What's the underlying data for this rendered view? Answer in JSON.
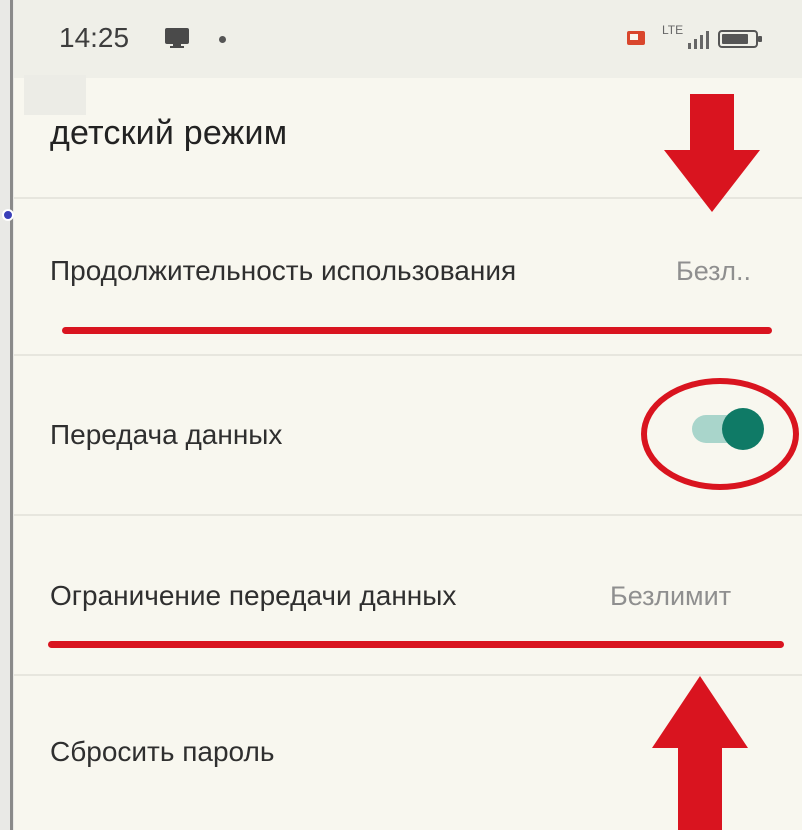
{
  "status_bar": {
    "time": "14:25",
    "network_label": "LTE",
    "notification_icon": "monitor-icon",
    "cast_icon": "cast-icon",
    "signal_icon": "signal-icon",
    "battery_icon": "battery-icon"
  },
  "header": {
    "title": "детский режим"
  },
  "settings": {
    "usage_duration": {
      "label": "Продолжительность использования",
      "value": "Безл.."
    },
    "data_transfer": {
      "label": "Передача данных",
      "toggle_on": true
    },
    "data_limit": {
      "label": "Ограничение передачи данных",
      "value": "Безлимит"
    },
    "reset_password": {
      "label": "Сбросить пароль"
    }
  },
  "colors": {
    "background": "#f8f7ef",
    "toggle_accent": "#0f7a66",
    "toggle_track": "#a9d5cb",
    "annotation_red": "#d9141f"
  }
}
